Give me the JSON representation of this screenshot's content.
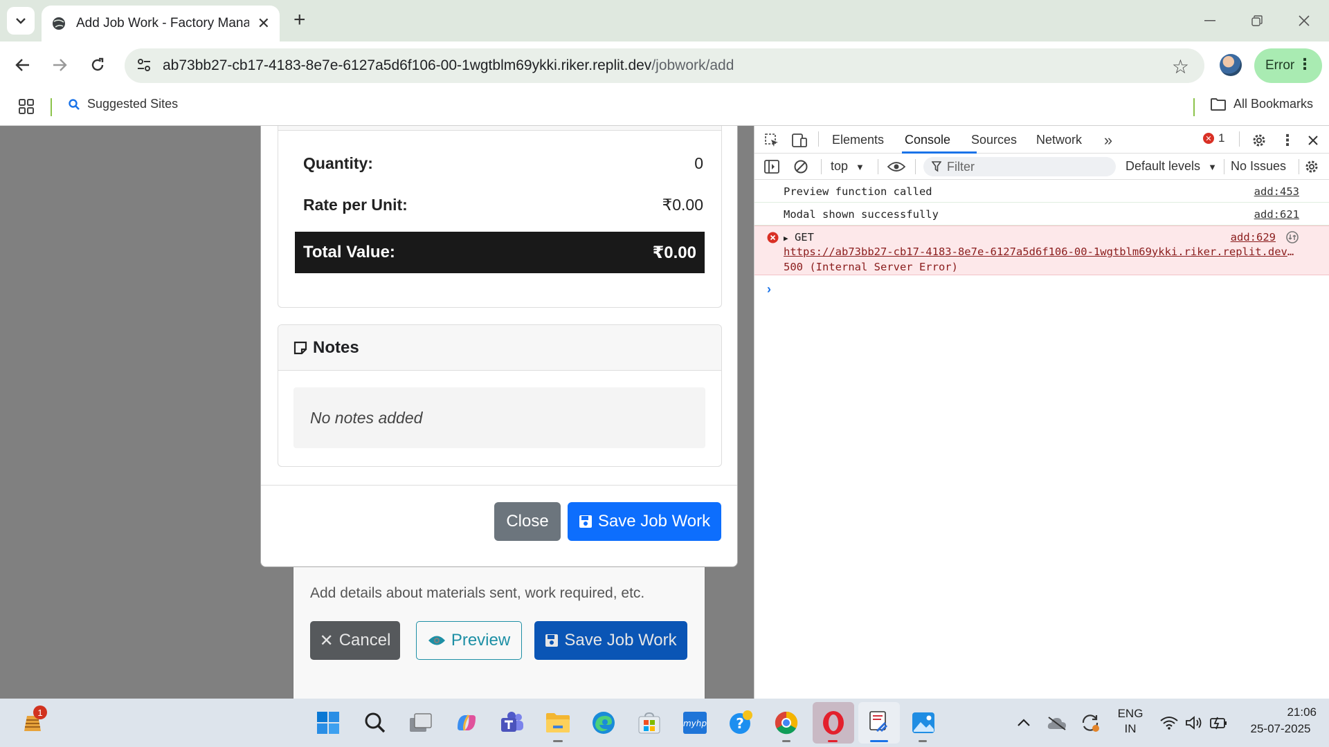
{
  "browser": {
    "tab_title": "Add Job Work - Factory Manag",
    "url_host": "ab73bb27-cb17-4183-8e7e-6127a5d6f106-00-1wgtblm69ykki.riker.replit.dev",
    "url_path": "/jobwork/add",
    "profile_status": "Error",
    "bookmarks": {
      "suggested": "Suggested Sites",
      "all": "All Bookmarks"
    }
  },
  "modal": {
    "summary": {
      "quantity_label": "Quantity:",
      "quantity_value": "0",
      "rate_label": "Rate per Unit:",
      "rate_value": "₹0.00",
      "total_label": "Total Value:",
      "total_value": "₹0.00"
    },
    "notes": {
      "title": "Notes",
      "empty_text": "No notes added"
    },
    "buttons": {
      "close": "Close",
      "save": "Save Job Work"
    }
  },
  "form": {
    "notes_hint": "Add details about materials sent, work required, etc.",
    "buttons": {
      "cancel": "Cancel",
      "preview": "Preview",
      "save": "Save Job Work"
    }
  },
  "devtools": {
    "tabs": [
      "Elements",
      "Console",
      "Sources",
      "Network"
    ],
    "active_tab": "Console",
    "error_count": "1",
    "context": "top",
    "filter_placeholder": "Filter",
    "levels": "Default levels",
    "issues": "No Issues",
    "logs": [
      {
        "message": "Preview function called",
        "source": "add:453"
      },
      {
        "message": "Modal shown successfully",
        "source": "add:621"
      }
    ],
    "error_log": {
      "method": "GET",
      "source": "add:629",
      "url": "https://ab73bb27-cb17-4183-8e7e-6127a5d6f106-00-1wgtblm69ykki.riker.replit.dev/...",
      "status": "500 (Internal Server Error)"
    }
  },
  "taskbar": {
    "widget_badge": "1",
    "lang_line1": "ENG",
    "lang_line2": "IN",
    "time": "21:06",
    "date": "25-07-2025"
  },
  "colors": {
    "tabbar_bg": "#dfe8df",
    "accent_green": "#a9ebb2",
    "primary_blue": "#0d6efd",
    "console_error_bg": "#fde8ea"
  }
}
